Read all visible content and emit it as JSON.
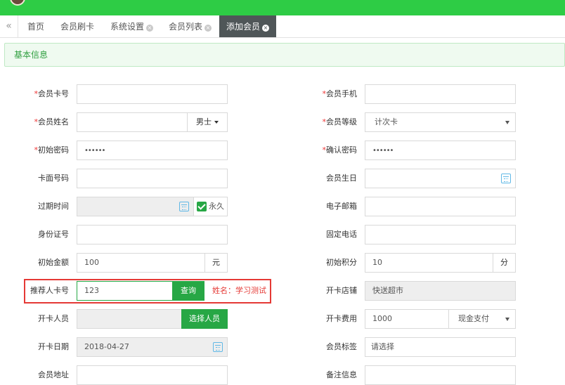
{
  "header": {
    "avatar": "avatar"
  },
  "tabs": {
    "prev_icon": "«",
    "home": "首页",
    "card_swipe": "会员刷卡",
    "settings": "系统设置",
    "member_list": "会员列表",
    "add_member": "添加会员"
  },
  "section": {
    "title": "基本信息"
  },
  "form": {
    "card_no_label": "会员卡号",
    "phone_label": "会员手机",
    "name_label": "会员姓名",
    "gender_value": "男士",
    "level_label": "会员等级",
    "level_value": "计次卡",
    "init_pwd_label": "初始密码",
    "init_pwd_value": "••••••",
    "confirm_pwd_label": "确认密码",
    "confirm_pwd_value": "••••••",
    "face_no_label": "卡面号码",
    "birthday_label": "会员生日",
    "expire_label": "过期时间",
    "forever_label": "永久",
    "email_label": "电子邮箱",
    "idcard_label": "身份证号",
    "tel_label": "固定电话",
    "init_amount_label": "初始金额",
    "init_amount_value": "100",
    "init_amount_unit": "元",
    "init_points_label": "初始积分",
    "init_points_value": "10",
    "init_points_unit": "分",
    "referrer_label": "推荐人卡号",
    "referrer_value": "123",
    "query_button": "查询",
    "referrer_name": "姓名：学习测试",
    "store_label": "开卡店铺",
    "store_value": "快送超市",
    "staff_label": "开卡人员",
    "select_staff_button": "选择人员",
    "fee_label": "开卡费用",
    "fee_value": "1000",
    "pay_method": "现金支付",
    "open_date_label": "开卡日期",
    "open_date_value": "2018-04-27",
    "tag_label": "会员标签",
    "tag_placeholder": "请选择",
    "address_label": "会员地址",
    "remark_label": "备注信息"
  },
  "colors": {
    "accent": "#2ecc45",
    "button": "#27a745",
    "alert": "#e53935"
  }
}
